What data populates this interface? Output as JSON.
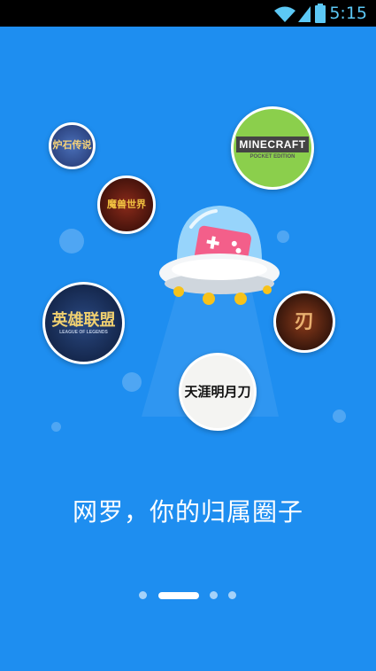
{
  "status_bar": {
    "time": "5:15",
    "icons": [
      "wifi-icon",
      "signal-icon",
      "battery-icon"
    ]
  },
  "games": [
    {
      "name": "hearthstone",
      "label": "炉石传说"
    },
    {
      "name": "warcraft",
      "label": "魔兽世界"
    },
    {
      "name": "minecraft",
      "label": "MINECRAFT",
      "sublabel": "POCKET EDITION"
    },
    {
      "name": "league-of-legends",
      "label": "英雄联盟",
      "sublabel": "LEAGUE OF LEGENDS"
    },
    {
      "name": "dark-game",
      "label": "刃"
    },
    {
      "name": "moonlight-blade",
      "label": "天涯明月刀"
    }
  ],
  "mascot_icon": "ufo-gamepad-icon",
  "tagline": "网罗，你的归属圈子",
  "pagination": {
    "pages": 4,
    "active": 1
  },
  "colors": {
    "background": "#1e8ef0",
    "status_bar": "#000000",
    "status_text": "#5cc8f5"
  }
}
